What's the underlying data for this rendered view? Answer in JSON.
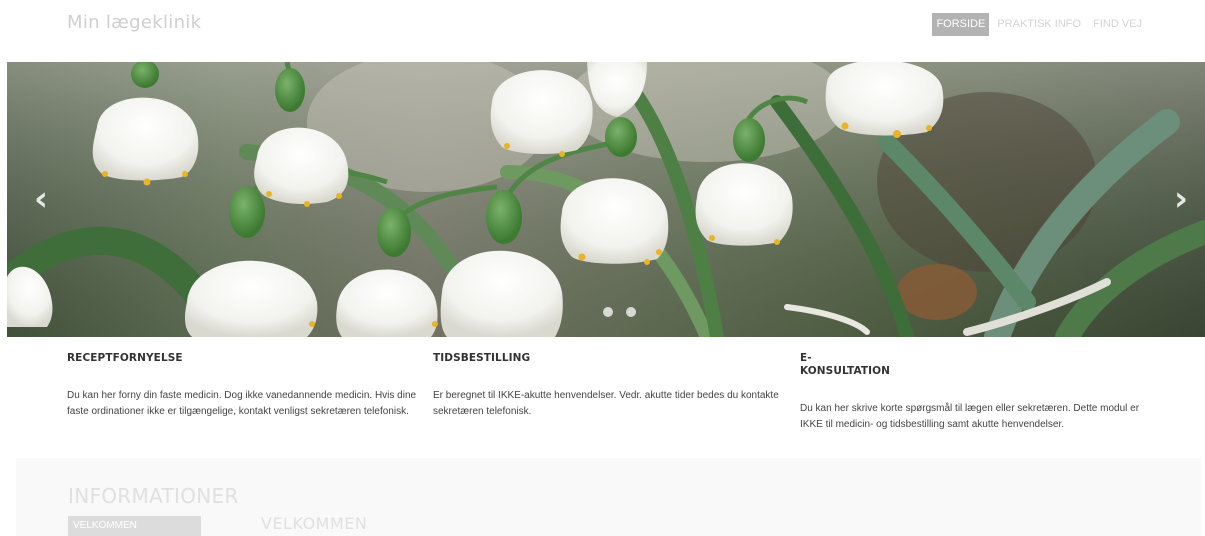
{
  "header": {
    "brand": "Min lægeklinik",
    "nav": [
      "FORSIDE",
      "PRAKTISK INFO",
      "FIND VEJ"
    ],
    "active": "FORSIDE"
  },
  "carousel": {
    "prev_icon": "chevron-left-icon",
    "next_icon": "chevron-right-icon",
    "slide_count": 2
  },
  "columns": [
    {
      "heading": "RECEPTFORNYELSE",
      "text": "Du kan her forny din faste medicin. Dog ikke vanedannende medicin. Hvis dine faste ordinationer ikke er tilgængelige, kontakt venligst sekretæren telefonisk."
    },
    {
      "heading": "TIDSBESTILLING",
      "text": "Er beregnet til IKKE-akutte henvendelser. Vedr. akutte tider bedes du kontakte sekretæren telefonisk."
    },
    {
      "heading": "E-KONSULTATION",
      "text": "Du kan her skrive korte spørgsmål til lægen eller sekretæren. Dette modul er IKKE til medicin- og tidsbestilling samt akutte henvendelser."
    }
  ],
  "info": {
    "title": "INFORMATIONER",
    "tab": "VELKOMMEN",
    "heading": "VELKOMMEN"
  },
  "colors": {
    "nav_active_bg": "#b3b3b3",
    "brand": "#cfcfcf"
  }
}
